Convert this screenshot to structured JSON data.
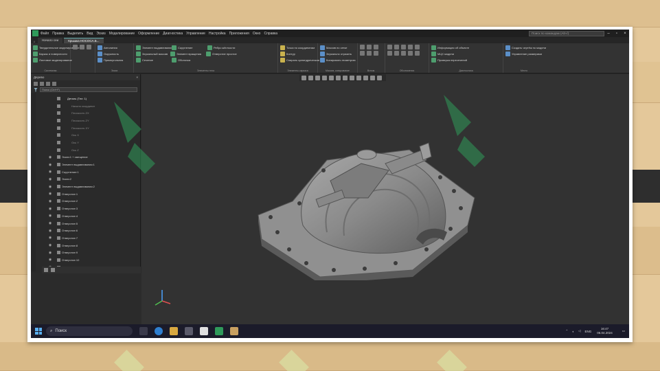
{
  "app": {
    "menu": [
      "Файл",
      "Правка",
      "Выделить",
      "Вид",
      "Эскиз",
      "Моделирование",
      "Оформление",
      "Диагностика",
      "Управление",
      "Настройка",
      "Приложения",
      "Окно",
      "Справка"
    ],
    "search_placeholder": "Поиск по командам (Alt+/)"
  },
  "tabs": {
    "home_tab": "Начало сеи",
    "active_tab": "Крышка НОСОСА.Б..."
  },
  "ribbon": {
    "groups": [
      {
        "name": "Системная",
        "items": [
          "Твердотельное моделирование",
          "Каркас и поверхности",
          "Листовое моделирование"
        ]
      },
      {
        "name": "Эскиз",
        "items": [
          "Автолиния",
          "Окружность",
          "Прямоугольник"
        ]
      },
      {
        "name": "Элементы тела",
        "items": [
          "Элемент выдавливания",
          "Элемент вращения",
          "Скругление",
          "Отверстие простое",
          "Ребро жёсткости",
          "Сечение",
          "Зеркальный массив",
          "Массив по сетке",
          "Оболочка",
          "Уклон"
        ]
      },
      {
        "name": "Элементы каркаса",
        "items": [
          "Точка по координатам",
          "Контур",
          "Спираль цилиндрическая"
        ]
      },
      {
        "name": "Массив, копирование",
        "items": [
          "Массив по сетке",
          "Зеркально отразить",
          "Копировать геометрию"
        ]
      },
      {
        "name": "Вспом.",
        "items": []
      },
      {
        "name": "Обозначения",
        "items": []
      },
      {
        "name": "Диагностика",
        "items": [
          "Информация об объекте",
          "МЦХ модели",
          "Проверка пересечений"
        ]
      },
      {
        "name": "Место",
        "items": [
          "Создать чертёж по модели",
          "Управление размерами"
        ]
      }
    ]
  },
  "sidebar": {
    "title": "Дерево",
    "filter_placeholder": "Поиск (Ctrl+F)",
    "tree": [
      {
        "label": "Деталь (Тел: 1)",
        "state": "header"
      },
      {
        "label": "Начало координат",
        "state": "dim"
      },
      {
        "label": "Плоскость ZX",
        "state": "dim"
      },
      {
        "label": "Плоскость ZY",
        "state": "dim"
      },
      {
        "label": "Плоскость XY",
        "state": "dim"
      },
      {
        "label": "Ось X",
        "state": "dim"
      },
      {
        "label": "Ось Y",
        "state": "dim"
      },
      {
        "label": "Ось Z",
        "state": "dim"
      },
      {
        "label": "Эскиз:1 + смещение",
        "state": "normal"
      },
      {
        "label": "Элемент выдавливания:1",
        "state": "normal"
      },
      {
        "label": "Скругление:1",
        "state": "normal"
      },
      {
        "label": "Эскиз:2",
        "state": "normal"
      },
      {
        "label": "Элемент выдавливания:2",
        "state": "normal"
      },
      {
        "label": "Отверстие:1",
        "state": "normal"
      },
      {
        "label": "Отверстие:2",
        "state": "normal"
      },
      {
        "label": "Отверстие:3",
        "state": "normal"
      },
      {
        "label": "Отверстие:4",
        "state": "normal"
      },
      {
        "label": "Отверстие:5",
        "state": "normal"
      },
      {
        "label": "Отверстие:6",
        "state": "normal"
      },
      {
        "label": "Отверстие:7",
        "state": "normal"
      },
      {
        "label": "Отверстие:8",
        "state": "normal"
      },
      {
        "label": "Отверстие:9",
        "state": "normal"
      },
      {
        "label": "Отверстие:10",
        "state": "normal"
      },
      {
        "label": "Отверстие:11",
        "state": "normal"
      }
    ]
  },
  "taskbar": {
    "search": "Поиск",
    "lang": "ENG",
    "time": "16:47",
    "date": "06.04.2024"
  },
  "colors": {
    "accent": "#2f9a5a",
    "viewport": "#323232",
    "model": "#8e8e8e"
  }
}
